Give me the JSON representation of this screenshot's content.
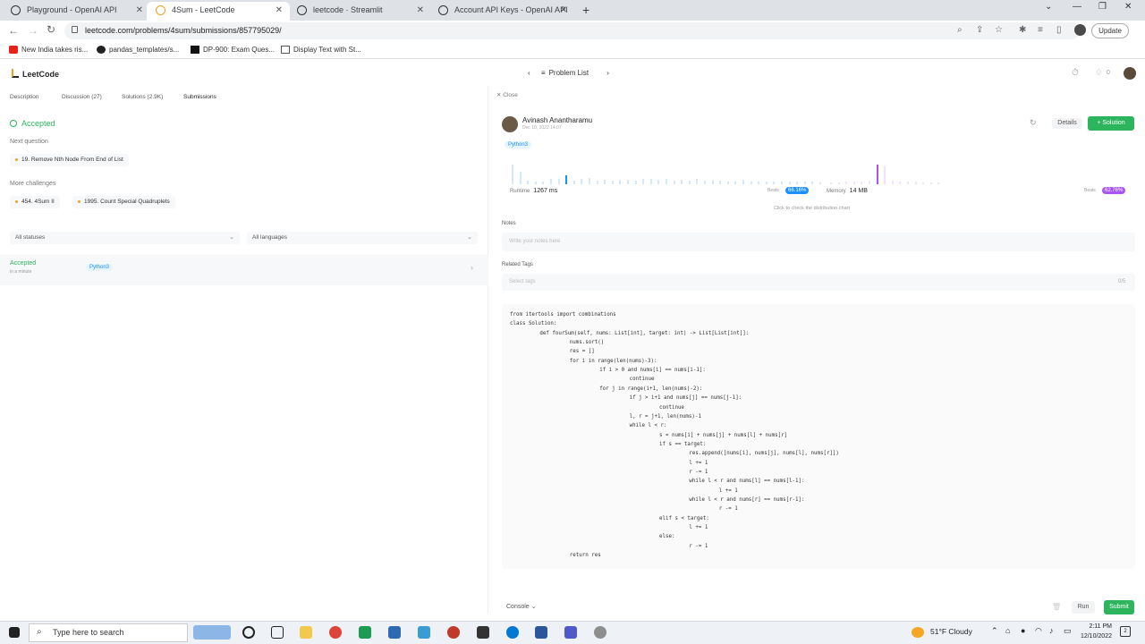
{
  "browser": {
    "tabs": [
      {
        "label": "Playground - OpenAI API",
        "active": false
      },
      {
        "label": "4Sum - LeetCode",
        "active": true
      },
      {
        "label": "leetcode · Streamlit",
        "active": false
      },
      {
        "label": "Account API Keys - OpenAI API",
        "active": false
      }
    ],
    "url": "leetcode.com/problems/4sum/submissions/857795029/",
    "update_label": "Update",
    "bookmarks": [
      "New India takes ris...",
      "pandas_templates/s...",
      "DP-900: Exam Ques...",
      "Display Text with St..."
    ]
  },
  "header": {
    "logo": "LeetCode",
    "problem_list": "Problem List",
    "streak_count": "0"
  },
  "left": {
    "tabs": [
      "Description",
      "Discussion (27)",
      "Solutions (2.9K)",
      "Submissions"
    ],
    "status": "Accepted",
    "next_label": "Next question",
    "next_question": "19. Remove Nth Node From End of List",
    "more_label": "More challenges",
    "challenges": [
      "454. 4Sum II",
      "1995. Count Special Quadruplets"
    ],
    "status_filter": "All statuses",
    "lang_filter": "All languages",
    "submission": {
      "status": "Accepted",
      "time": "in a minute",
      "language": "Python3"
    }
  },
  "right": {
    "close": "Close",
    "user": "Avinash Anantharamu",
    "date": "Dec 10, 2022 14:07",
    "language": "Python3",
    "details": "Details",
    "solution": "+ Solution",
    "runtime_label": "Runtime",
    "runtime_value": "1267 ms",
    "runtime_beats": "66.16%",
    "memory_label": "Memory",
    "memory_value": "14 MB",
    "memory_beats": "62.76%",
    "beats_label": "Beats",
    "dist_link": "Click to check the distribution chart",
    "notes_label": "Notes",
    "notes_placeholder": "Write your notes here",
    "tags_label": "Related Tags",
    "tags_placeholder": "Select tags",
    "tags_count": "0/5",
    "console": "Console",
    "run": "Run",
    "submit": "Submit"
  },
  "code_lines": [
    "from itertools import combinations",
    "class Solution:",
    "    def fourSum(self, nums: List[int], target: int) -> List[List[int]]:",
    "        nums.sort()",
    "        res = []",
    "        for i in range(len(nums)-3):",
    "            if i > 0 and nums[i] == nums[i-1]:",
    "                continue",
    "            for j in range(i+1, len(nums)-2):",
    "                if j > i+1 and nums[j] == nums[j-1]:",
    "                    continue",
    "                l, r = j+1, len(nums)-1",
    "                while l < r:",
    "                    s = nums[i] + nums[j] + nums[l] + nums[r]",
    "                    if s == target:",
    "                        res.append([nums[i], nums[j], nums[l], nums[r]])",
    "                        l += 1",
    "                        r -= 1",
    "                        while l < r and nums[l] == nums[l-1]:",
    "                            l += 1",
    "                        while l < r and nums[r] == nums[r-1]:",
    "                            r -= 1",
    "                    elif s < target:",
    "                        l += 1",
    "                    else:",
    "                        r -= 1",
    "        return res"
  ],
  "taskbar": {
    "search_placeholder": "Type here to search",
    "weather": "51°F  Cloudy",
    "time": "2:11 PM",
    "date": "12/10/2022",
    "notif_count": "2"
  },
  "colors": {
    "accent": "#2db55d",
    "tag": "#1a90ff",
    "runtime_badge": "#1a90ff",
    "memory_badge": "#a855f7"
  }
}
